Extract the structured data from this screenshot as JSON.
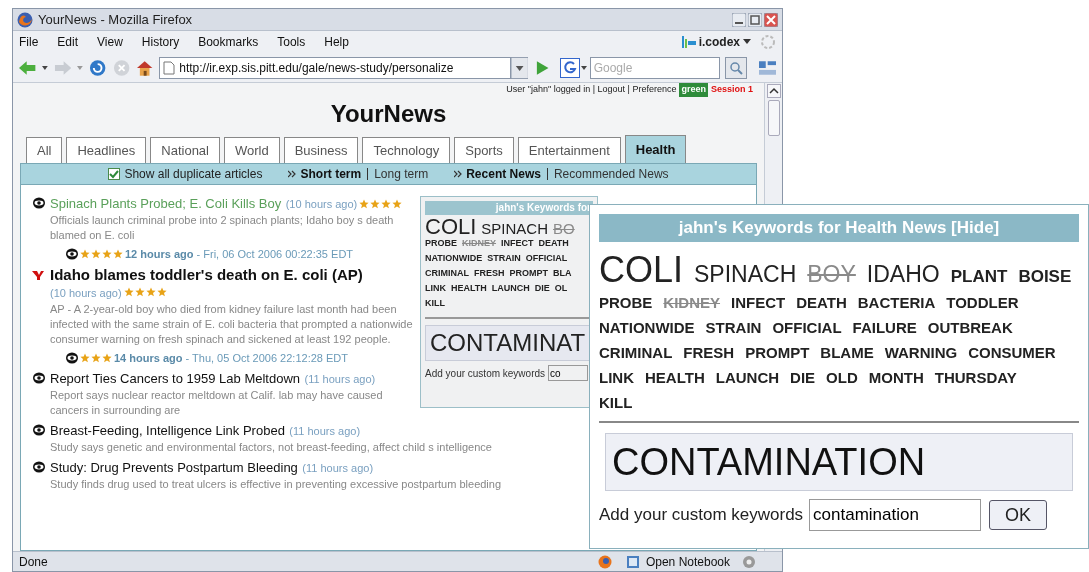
{
  "window": {
    "title": "YourNews - Mozilla Firefox"
  },
  "menu": [
    "File",
    "Edit",
    "View",
    "History",
    "Bookmarks",
    "Tools",
    "Help"
  ],
  "toolbar_brand": "i.codex",
  "address": "http://ir.exp.sis.pitt.edu/gale/news-study/personalize",
  "search": {
    "placeholder": "Google"
  },
  "user_bar": {
    "text": "User \"jahn\" logged in | Logout | Preference",
    "preference": "green",
    "session": "Session 1"
  },
  "site_title": "YourNews",
  "tabs": [
    {
      "label": "All",
      "selected": false
    },
    {
      "label": "Headlines",
      "selected": false
    },
    {
      "label": "National",
      "selected": false
    },
    {
      "label": "World",
      "selected": false
    },
    {
      "label": "Business",
      "selected": false
    },
    {
      "label": "Technology",
      "selected": false
    },
    {
      "label": "Sports",
      "selected": false
    },
    {
      "label": "Entertainment",
      "selected": false
    },
    {
      "label": "Health",
      "selected": true
    }
  ],
  "options": {
    "duplicates": {
      "label": "Show all duplicate articles",
      "checked": true
    },
    "term": [
      {
        "label": "Short term",
        "selected": true
      },
      {
        "label": "Long term",
        "selected": false
      }
    ],
    "news": [
      {
        "label": "Recent News",
        "selected": true
      },
      {
        "label": "Recommended News",
        "selected": false
      }
    ]
  },
  "articles": [
    {
      "kind": "visited",
      "title": "Spinach Plants Probed; E. Coli Kills Boy",
      "time": "(10 hours ago)",
      "stars": 4,
      "snippet": "Officials launch criminal probe into 2 spinach plants; Idaho boy s death blamed on E. coli"
    },
    {
      "header": {
        "stars": 4,
        "time": "12 hours ago",
        "date": " - Fri, 06 Oct 2006 00:22:35 EDT"
      },
      "kind": "featured",
      "title": "Idaho blames toddler's death on E. coli (AP)",
      "time": "(10 hours ago)",
      "stars": 4,
      "snippet": "AP - A 2-year-old boy who died from kidney failure last month had been infected with the same strain of E. coli bacteria that prompted a nationwide consumer warning on fresh spinach and sickened at least 192 people."
    },
    {
      "header": {
        "stars": 3,
        "time": "14 hours ago",
        "date": " - Thu, 05 Oct 2006 22:12:28 EDT"
      },
      "kind": "normal",
      "title": "Report Ties Cancers to 1959 Lab Meltdown",
      "time": "(11 hours ago)",
      "snippet": "Report says nuclear reactor meltdown at Calif. lab may have caused cancers in surrounding are"
    },
    {
      "kind": "normal",
      "title": "Breast-Feeding, Intelligence Link Probed",
      "time": "(11 hours ago)",
      "snippet": "Study says genetic and environmental factors, not breast-feeding, affect child s intelligence"
    },
    {
      "kind": "normal",
      "title": "Study: Drug Prevents Postpartum Bleeding",
      "time": "(11 hours ago)",
      "snippet": "Study finds drug used to treat ulcers is effective in preventing excessive postpartum bleeding"
    }
  ],
  "keyword_panel": {
    "title": "jahn's Keywords for",
    "rows": [
      [
        {
          "text": "COLI",
          "kind": "huge",
          "removed": false
        },
        {
          "text": "SPINACH",
          "kind": "large",
          "removed": false
        },
        {
          "text": "BO",
          "kind": "large",
          "removed": true
        }
      ],
      [
        {
          "text": "PROBE",
          "kind": "small",
          "removed": false
        },
        {
          "text": "KIDNEY",
          "kind": "small",
          "removed": true
        },
        {
          "text": "INFECT",
          "kind": "small",
          "removed": false
        },
        {
          "text": "DEATH",
          "kind": "small",
          "removed": false
        }
      ],
      [
        {
          "text": "NATIONWIDE",
          "kind": "small",
          "removed": false
        },
        {
          "text": "STRAIN",
          "kind": "small",
          "removed": false
        },
        {
          "text": "OFFICIAL",
          "kind": "small",
          "removed": false
        }
      ],
      [
        {
          "text": "CRIMINAL",
          "kind": "small",
          "removed": false
        },
        {
          "text": "FRESH",
          "kind": "small",
          "removed": false
        },
        {
          "text": "PROMPT",
          "kind": "small",
          "removed": false
        },
        {
          "text": "BLA",
          "kind": "small",
          "removed": false
        }
      ],
      [
        {
          "text": "LINK",
          "kind": "small",
          "removed": false
        },
        {
          "text": "HEALTH",
          "kind": "small",
          "removed": false
        },
        {
          "text": "LAUNCH",
          "kind": "small",
          "removed": false
        },
        {
          "text": "DIE",
          "kind": "small",
          "removed": false
        },
        {
          "text": "OL",
          "kind": "small",
          "removed": false
        }
      ],
      [
        {
          "text": "KILL",
          "kind": "small",
          "removed": false
        }
      ]
    ],
    "custom": "CONTAMINAT",
    "add_label": "Add your custom keywords",
    "input_value": "co"
  },
  "keyword_inset": {
    "title": "jahn's Keywords for Health News [Hide]",
    "rows": [
      [
        {
          "text": "COLI",
          "kind": "huge",
          "removed": false
        },
        {
          "text": "SPINACH",
          "kind": "large",
          "removed": false
        },
        {
          "text": "BOY",
          "kind": "large",
          "removed": true
        },
        {
          "text": "IDAHO",
          "kind": "large",
          "removed": false
        },
        {
          "text": "PLANT",
          "kind": "medium",
          "removed": false
        },
        {
          "text": "BOISE",
          "kind": "medium",
          "removed": false
        }
      ],
      [
        {
          "text": "PROBE",
          "kind": "small",
          "removed": false
        },
        {
          "text": "KIDNEY",
          "kind": "small",
          "removed": true
        },
        {
          "text": "INFECT",
          "kind": "small",
          "removed": false
        },
        {
          "text": "DEATH",
          "kind": "small",
          "removed": false
        },
        {
          "text": "BACTERIA",
          "kind": "small",
          "removed": false
        },
        {
          "text": "TODDLER",
          "kind": "small",
          "removed": false
        }
      ],
      [
        {
          "text": "NATIONWIDE",
          "kind": "small",
          "removed": false
        },
        {
          "text": "STRAIN",
          "kind": "small",
          "removed": false
        },
        {
          "text": "OFFICIAL",
          "kind": "small",
          "removed": false
        },
        {
          "text": "FAILURE",
          "kind": "small",
          "removed": false
        },
        {
          "text": "OUTBREAK",
          "kind": "small",
          "removed": false
        }
      ],
      [
        {
          "text": "CRIMINAL",
          "kind": "small",
          "removed": false
        },
        {
          "text": "FRESH",
          "kind": "small",
          "removed": false
        },
        {
          "text": "PROMPT",
          "kind": "small",
          "removed": false
        },
        {
          "text": "BLAME",
          "kind": "small",
          "removed": false
        },
        {
          "text": "WARNING",
          "kind": "small",
          "removed": false
        },
        {
          "text": "CONSUMER",
          "kind": "small",
          "removed": false
        }
      ],
      [
        {
          "text": "LINK",
          "kind": "small",
          "removed": false
        },
        {
          "text": "HEALTH",
          "kind": "small",
          "removed": false
        },
        {
          "text": "LAUNCH",
          "kind": "small",
          "removed": false
        },
        {
          "text": "DIE",
          "kind": "small",
          "removed": false
        },
        {
          "text": "OLD",
          "kind": "small",
          "removed": false
        },
        {
          "text": "MONTH",
          "kind": "small",
          "removed": false
        },
        {
          "text": "THURSDAY",
          "kind": "small",
          "removed": false
        }
      ],
      [
        {
          "text": "KILL",
          "kind": "small",
          "removed": false
        }
      ]
    ],
    "custom": "CONTAMINATION",
    "add_label": "Add your custom keywords",
    "input_value": "contamination",
    "button": "OK"
  },
  "status_bar": {
    "text": "Done",
    "notebook": "Open Notebook"
  }
}
